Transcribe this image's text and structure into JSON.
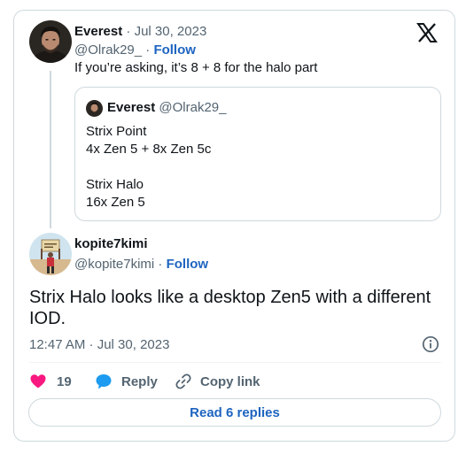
{
  "parent_tweet": {
    "name": "Everest",
    "date_sep": " · ",
    "date": "Jul 30, 2023",
    "handle": "@Olrak29_",
    "follow_sep": " · ",
    "follow_label": "Follow",
    "text": "If you’re asking, it’s 8 + 8 for the halo part"
  },
  "quoted_tweet": {
    "name": "Everest",
    "handle": "@Olrak29_",
    "lines": [
      "Strix Point",
      "4x Zen 5 + 8x Zen 5c",
      "",
      "Strix Halo",
      "16x Zen 5"
    ]
  },
  "main_tweet": {
    "name": "kopite7kimi",
    "handle": "@kopite7kimi",
    "follow_sep": " · ",
    "follow_label": "Follow",
    "text": "Strix Halo looks like a desktop Zen5 with a different IOD.",
    "timestamp": "12:47 AM · Jul 30, 2023"
  },
  "actions": {
    "like_count": "19",
    "reply_label": "Reply",
    "copy_label": "Copy link"
  },
  "read_replies_label": "Read 6 replies",
  "colors": {
    "like": "#f91880",
    "reply": "#1d9bf0",
    "link": "#1d64c0",
    "muted": "#536471",
    "border": "#cfd9de"
  },
  "icons": {
    "logo": "x-logo-icon",
    "info": "info-icon",
    "like": "heart-icon",
    "reply": "speech-bubble-icon",
    "copy": "link-icon"
  }
}
